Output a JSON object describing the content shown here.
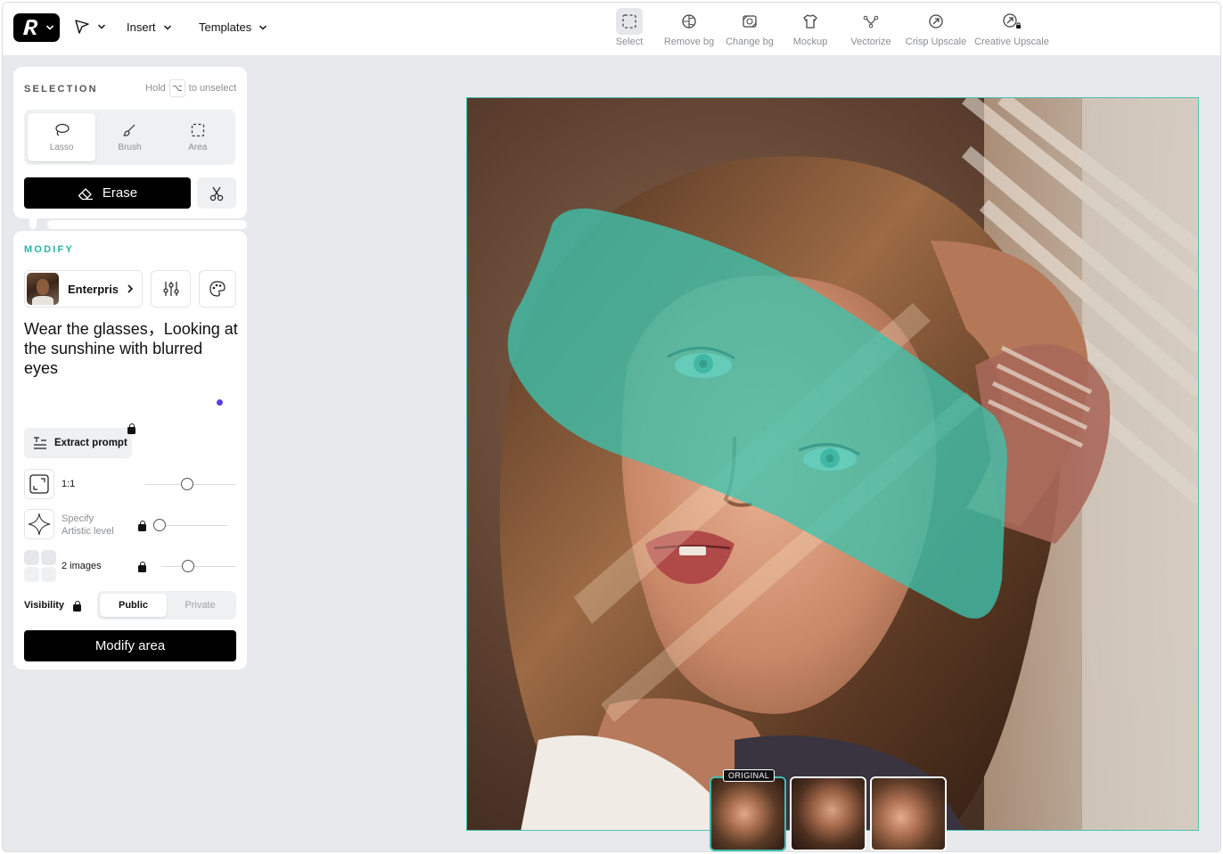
{
  "topbar": {
    "insert_label": "Insert",
    "templates_label": "Templates",
    "tools": [
      {
        "label": "Select",
        "icon": "select-icon",
        "active": true
      },
      {
        "label": "Remove bg",
        "icon": "remove-bg-icon"
      },
      {
        "label": "Change bg",
        "icon": "change-bg-icon"
      },
      {
        "label": "Mockup",
        "icon": "tshirt-icon"
      },
      {
        "label": "Vectorize",
        "icon": "vectorize-icon"
      },
      {
        "label": "Crisp Upscale",
        "icon": "crisp-upscale-icon"
      },
      {
        "label": "Creative Upscale",
        "icon": "creative-upscale-icon"
      }
    ]
  },
  "selection": {
    "title": "SELECTION",
    "hint_prefix": "Hold",
    "hint_key": "⌥",
    "hint_suffix": "to unselect",
    "modes": [
      {
        "label": "Lasso",
        "icon": "lasso-icon",
        "active": true
      },
      {
        "label": "Brush",
        "icon": "brush-icon"
      },
      {
        "label": "Area",
        "icon": "area-icon"
      }
    ],
    "erase_label": "Erase"
  },
  "modify": {
    "title": "MODIFY",
    "model_label": "Enterprise",
    "prompt": "Wear the glasses，Looking at the sunshine with blurred eyes",
    "extract_label": "Extract prompt",
    "aspect_label": "1:1",
    "artistic_label_1": "Specify",
    "artistic_label_2": "Artistic level",
    "images_label": "2 images",
    "visibility_label": "Visibility",
    "visibility_options": [
      "Public",
      "Private"
    ],
    "visibility_selected": "Public",
    "submit_label": "Modify area"
  },
  "canvas": {
    "original_badge": "ORIGINAL",
    "mask_color": "#3ec3ad"
  },
  "colors": {
    "accent": "#3fbfae",
    "modify_title": "#2bb3a0",
    "dot": "#5b3fe0"
  }
}
